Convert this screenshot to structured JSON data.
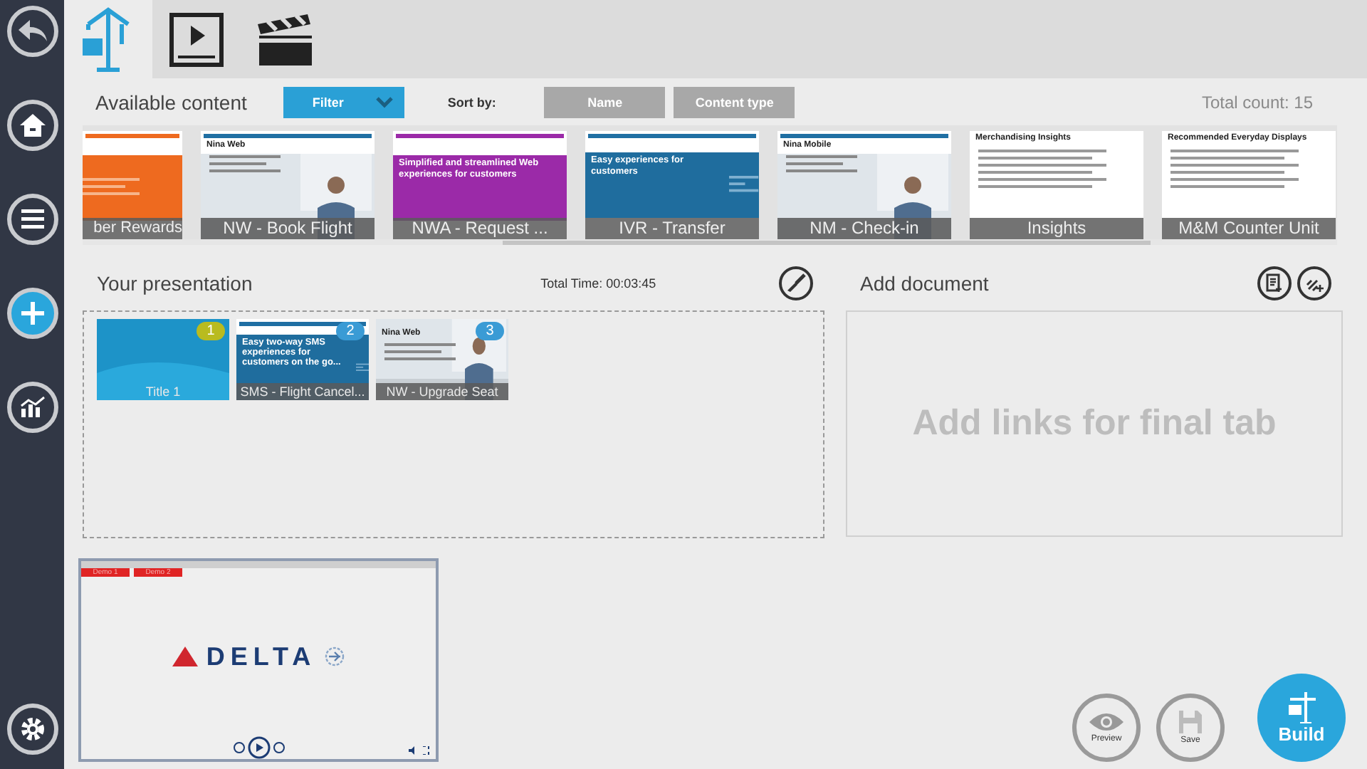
{
  "sidebar": {
    "items": [
      {
        "kind": "back",
        "selected": false
      },
      {
        "kind": "home",
        "selected": false
      },
      {
        "kind": "menu",
        "selected": false
      },
      {
        "kind": "add",
        "selected": true
      },
      {
        "kind": "chart",
        "selected": false
      }
    ],
    "settings": {
      "kind": "gear"
    }
  },
  "tabs": [
    {
      "kind": "build",
      "selected": true
    },
    {
      "kind": "video",
      "selected": false
    },
    {
      "kind": "clapper",
      "selected": false
    }
  ],
  "available": {
    "title": "Available content",
    "filter": "Filter",
    "sort_label": "Sort by:",
    "sort_options": [
      "Name",
      "Content type"
    ],
    "total": "Total count: 15",
    "items": [
      {
        "kind": "orange",
        "label": "ber Rewards",
        "partial": true
      },
      {
        "kind": "web",
        "label": "NW - Book Flight",
        "heading": "Nina Web"
      },
      {
        "kind": "purple",
        "label": "NWA - Request ...",
        "heading": "Simplified and streamlined Web experiences for  customers"
      },
      {
        "kind": "blue",
        "label": "IVR - Transfer",
        "heading": "Easy experiences for customers"
      },
      {
        "kind": "mobile",
        "label": "NM - Check-in",
        "heading": "Nina Mobile"
      },
      {
        "kind": "doc",
        "label": "Insights",
        "heading": "Merchandising Insights"
      },
      {
        "kind": "doc",
        "label": "M&M Counter Unit",
        "heading": "Recommended Everyday Displays"
      }
    ]
  },
  "presentation": {
    "title": "Your presentation",
    "total_time": "Total Time: 00:03:45",
    "items": [
      {
        "kind": "title",
        "number": "1",
        "label": "Title 1",
        "selected": true
      },
      {
        "kind": "blue",
        "number": "2",
        "label": "SMS - Flight Cancel...",
        "heading": "Easy two-way SMS experiences for  customers on the go...",
        "selected": false
      },
      {
        "kind": "web",
        "number": "3",
        "label": "NW - Upgrade Seat",
        "heading": "Nina Web",
        "selected": false
      }
    ]
  },
  "document": {
    "title": "Add document",
    "placeholder": "Add links for final tab"
  },
  "player": {
    "tabs": [
      "Demo 1",
      "Demo 2"
    ],
    "logo": "DELTA"
  },
  "actions": [
    {
      "kind": "preview",
      "label": "Preview"
    },
    {
      "kind": "save",
      "label": "Save"
    },
    {
      "kind": "build",
      "label": "Build"
    }
  ]
}
